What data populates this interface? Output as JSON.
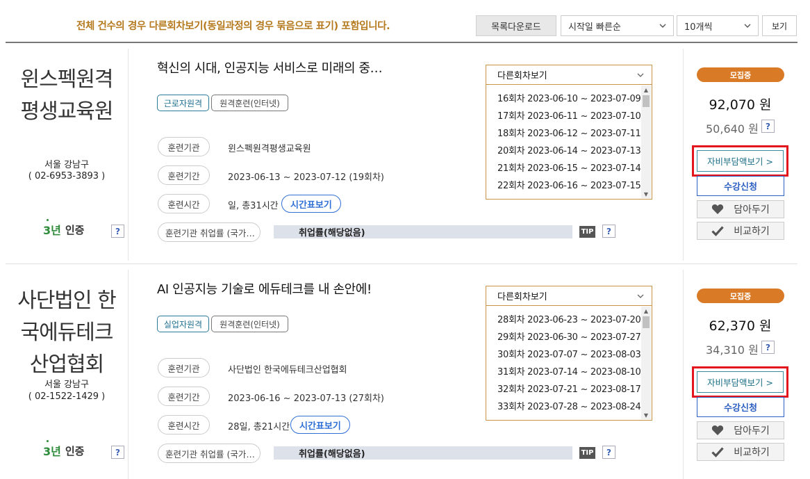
{
  "toolbar": {
    "notice": "전체 건수의 경우 다른회차보기(동일과정의 경우 묶음으로 표기) 포함입니다.",
    "download_label": "목록다운로드",
    "sort_selected": "시작일 빠른순",
    "count_selected": "10개씩",
    "view_label": "보기"
  },
  "labels": {
    "org": "훈련기관",
    "period": "훈련기간",
    "hours": "훈련시간",
    "employment": "훈련기관 취업률 (국가…",
    "time_table": "시간표보기",
    "employment_value": "취업률(해당없음)",
    "tip": "TIP",
    "question": "?",
    "rounds_header": "다른회차보기",
    "cert_num": "3년",
    "cert_text": "인증",
    "self_pay": "자비부담액보기 >",
    "apply": "수강신청",
    "wish": "담아두기",
    "compare": "비교하기",
    "scroll_up": "▲",
    "scroll_down": "▼"
  },
  "courses": [
    {
      "org_name_lines": [
        "윈스펙원격",
        "평생교육원"
      ],
      "location": "서울 강남구",
      "phone": "( 02-6953-3893 )",
      "title": "혁신의 시대, 인공지능 서비스로 미래의 중…",
      "tag_type": "근로자원격",
      "tag_mode": "원격훈련(인터넷)",
      "org_value": "윈스펙원격평생교육원",
      "period_value": "2023-06-13 ~ 2023-07-12 (19회차)",
      "hours_value": "일, 총31시간",
      "rounds": [
        "16회차 2023-06-10 ~ 2023-07-09",
        "17회차 2023-06-11 ~ 2023-07-10",
        "18회차 2023-06-12 ~ 2023-07-11",
        "20회차 2023-06-14 ~ 2023-07-13",
        "21회차 2023-06-15 ~ 2023-07-14",
        "22회차 2023-06-16 ~ 2023-07-15"
      ],
      "status": "모집중",
      "price": "92,070 원",
      "self_price": "50,640 원"
    },
    {
      "org_name_lines": [
        "사단법인 한",
        "국에듀테크",
        "산업협회"
      ],
      "location": "서울 강남구",
      "phone": "( 02-1522-1429 )",
      "title": "AI 인공지능 기술로 에듀테크를 내 손안에!",
      "tag_type": "실업자원격",
      "tag_mode": "원격훈련(인터넷)",
      "org_value": "사단법인 한국에듀테크산업협회",
      "period_value": "2023-06-16 ~ 2023-07-13 (27회차)",
      "hours_value": "28일, 총21시간",
      "rounds": [
        "28회차 2023-06-23 ~ 2023-07-20",
        "29회차 2023-06-30 ~ 2023-07-27",
        "30회차 2023-07-07 ~ 2023-08-03",
        "31회차 2023-07-14 ~ 2023-08-10",
        "32회차 2023-07-21 ~ 2023-08-17",
        "33회차 2023-07-28 ~ 2023-08-24"
      ],
      "status": "모집중",
      "price": "62,370 원",
      "self_price": "34,310 원"
    }
  ],
  "colors": {
    "notice": "#b5791e",
    "badge": "#d97a26",
    "highlight_box": "#e3151d",
    "dropdown_border": "#c9934a",
    "link_blue": "#2f6fd6",
    "cert_green": "#2e8b3a"
  },
  "icons": {
    "chevron": "chevron-down-icon",
    "wish": "heart-icon",
    "compare": "checkmark-icon"
  }
}
